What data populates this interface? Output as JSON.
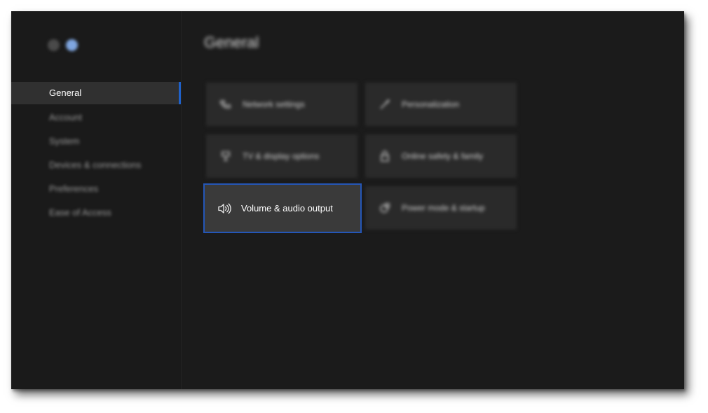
{
  "window": {
    "page_title": "General"
  },
  "sidebar": {
    "items": [
      {
        "label": "General"
      },
      {
        "label": "Account"
      },
      {
        "label": "System"
      },
      {
        "label": "Devices & connections"
      },
      {
        "label": "Preferences"
      },
      {
        "label": "Ease of Access"
      }
    ]
  },
  "tiles": [
    {
      "label": "Network settings",
      "icon": "network-icon"
    },
    {
      "label": "Personalization",
      "icon": "brush-icon"
    },
    {
      "label": "TV & display options",
      "icon": "display-icon"
    },
    {
      "label": "Online safety & family",
      "icon": "lock-icon"
    },
    {
      "label": "Volume & audio output",
      "icon": "speaker-icon"
    },
    {
      "label": "Power mode & startup",
      "icon": "power-icon"
    }
  ],
  "colors": {
    "background": "#1b1b1b",
    "tile": "#2a2a2a",
    "focused_tile": "#3a3a3a",
    "accent": "#1f61c9"
  }
}
